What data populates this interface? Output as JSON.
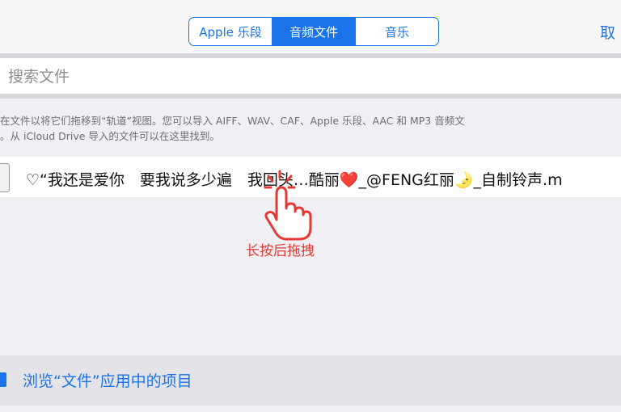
{
  "segmented": {
    "tabs": [
      {
        "label": "Apple 乐段"
      },
      {
        "label": "音频文件"
      },
      {
        "label": "音乐"
      }
    ],
    "selected": "音频文件"
  },
  "cancel_label": "取",
  "search": {
    "placeholder": "搜索文件",
    "value": ""
  },
  "info_lines": [
    "在文件以将它们拖移到“轨道”视图。您可以导入 AIFF、WAV、CAF、Apple 乐段、AAC 和 MP3 音频文",
    "。从 iCloud Drive 导入的文件可以在这里找到。"
  ],
  "file": {
    "name": "♡“我还是爱你　要我说多少遍　我回头…酷丽❤️_@FENG红丽🌛_自制铃声.m"
  },
  "drag_hint": "长按后拖拽",
  "browse_label": "浏览“文件”应用中的项目",
  "colors": {
    "accent": "#1a73e8",
    "hint": "#e53935"
  },
  "icons": [
    "file-icon",
    "hand-pointer-icon",
    "folder-icon"
  ]
}
